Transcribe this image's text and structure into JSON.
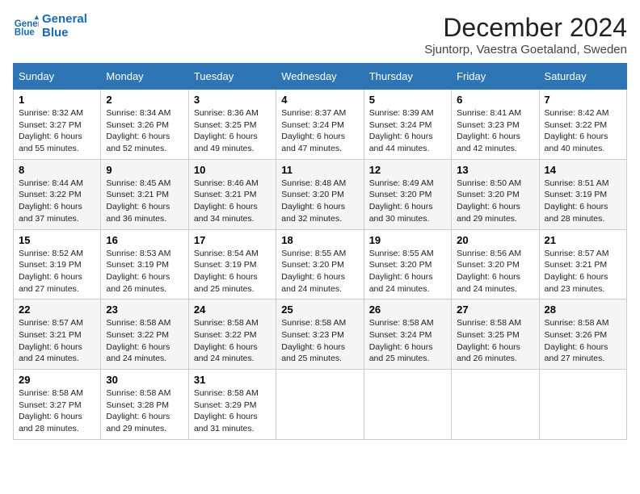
{
  "header": {
    "logo_line1": "General",
    "logo_line2": "Blue",
    "title": "December 2024",
    "subtitle": "Sjuntorp, Vaestra Goetaland, Sweden"
  },
  "columns": [
    "Sunday",
    "Monday",
    "Tuesday",
    "Wednesday",
    "Thursday",
    "Friday",
    "Saturday"
  ],
  "weeks": [
    [
      {
        "day": "1",
        "sunrise": "Sunrise: 8:32 AM",
        "sunset": "Sunset: 3:27 PM",
        "daylight": "Daylight: 6 hours and 55 minutes."
      },
      {
        "day": "2",
        "sunrise": "Sunrise: 8:34 AM",
        "sunset": "Sunset: 3:26 PM",
        "daylight": "Daylight: 6 hours and 52 minutes."
      },
      {
        "day": "3",
        "sunrise": "Sunrise: 8:36 AM",
        "sunset": "Sunset: 3:25 PM",
        "daylight": "Daylight: 6 hours and 49 minutes."
      },
      {
        "day": "4",
        "sunrise": "Sunrise: 8:37 AM",
        "sunset": "Sunset: 3:24 PM",
        "daylight": "Daylight: 6 hours and 47 minutes."
      },
      {
        "day": "5",
        "sunrise": "Sunrise: 8:39 AM",
        "sunset": "Sunset: 3:24 PM",
        "daylight": "Daylight: 6 hours and 44 minutes."
      },
      {
        "day": "6",
        "sunrise": "Sunrise: 8:41 AM",
        "sunset": "Sunset: 3:23 PM",
        "daylight": "Daylight: 6 hours and 42 minutes."
      },
      {
        "day": "7",
        "sunrise": "Sunrise: 8:42 AM",
        "sunset": "Sunset: 3:22 PM",
        "daylight": "Daylight: 6 hours and 40 minutes."
      }
    ],
    [
      {
        "day": "8",
        "sunrise": "Sunrise: 8:44 AM",
        "sunset": "Sunset: 3:22 PM",
        "daylight": "Daylight: 6 hours and 37 minutes."
      },
      {
        "day": "9",
        "sunrise": "Sunrise: 8:45 AM",
        "sunset": "Sunset: 3:21 PM",
        "daylight": "Daylight: 6 hours and 36 minutes."
      },
      {
        "day": "10",
        "sunrise": "Sunrise: 8:46 AM",
        "sunset": "Sunset: 3:21 PM",
        "daylight": "Daylight: 6 hours and 34 minutes."
      },
      {
        "day": "11",
        "sunrise": "Sunrise: 8:48 AM",
        "sunset": "Sunset: 3:20 PM",
        "daylight": "Daylight: 6 hours and 32 minutes."
      },
      {
        "day": "12",
        "sunrise": "Sunrise: 8:49 AM",
        "sunset": "Sunset: 3:20 PM",
        "daylight": "Daylight: 6 hours and 30 minutes."
      },
      {
        "day": "13",
        "sunrise": "Sunrise: 8:50 AM",
        "sunset": "Sunset: 3:20 PM",
        "daylight": "Daylight: 6 hours and 29 minutes."
      },
      {
        "day": "14",
        "sunrise": "Sunrise: 8:51 AM",
        "sunset": "Sunset: 3:19 PM",
        "daylight": "Daylight: 6 hours and 28 minutes."
      }
    ],
    [
      {
        "day": "15",
        "sunrise": "Sunrise: 8:52 AM",
        "sunset": "Sunset: 3:19 PM",
        "daylight": "Daylight: 6 hours and 27 minutes."
      },
      {
        "day": "16",
        "sunrise": "Sunrise: 8:53 AM",
        "sunset": "Sunset: 3:19 PM",
        "daylight": "Daylight: 6 hours and 26 minutes."
      },
      {
        "day": "17",
        "sunrise": "Sunrise: 8:54 AM",
        "sunset": "Sunset: 3:19 PM",
        "daylight": "Daylight: 6 hours and 25 minutes."
      },
      {
        "day": "18",
        "sunrise": "Sunrise: 8:55 AM",
        "sunset": "Sunset: 3:20 PM",
        "daylight": "Daylight: 6 hours and 24 minutes."
      },
      {
        "day": "19",
        "sunrise": "Sunrise: 8:55 AM",
        "sunset": "Sunset: 3:20 PM",
        "daylight": "Daylight: 6 hours and 24 minutes."
      },
      {
        "day": "20",
        "sunrise": "Sunrise: 8:56 AM",
        "sunset": "Sunset: 3:20 PM",
        "daylight": "Daylight: 6 hours and 24 minutes."
      },
      {
        "day": "21",
        "sunrise": "Sunrise: 8:57 AM",
        "sunset": "Sunset: 3:21 PM",
        "daylight": "Daylight: 6 hours and 23 minutes."
      }
    ],
    [
      {
        "day": "22",
        "sunrise": "Sunrise: 8:57 AM",
        "sunset": "Sunset: 3:21 PM",
        "daylight": "Daylight: 6 hours and 24 minutes."
      },
      {
        "day": "23",
        "sunrise": "Sunrise: 8:58 AM",
        "sunset": "Sunset: 3:22 PM",
        "daylight": "Daylight: 6 hours and 24 minutes."
      },
      {
        "day": "24",
        "sunrise": "Sunrise: 8:58 AM",
        "sunset": "Sunset: 3:22 PM",
        "daylight": "Daylight: 6 hours and 24 minutes."
      },
      {
        "day": "25",
        "sunrise": "Sunrise: 8:58 AM",
        "sunset": "Sunset: 3:23 PM",
        "daylight": "Daylight: 6 hours and 25 minutes."
      },
      {
        "day": "26",
        "sunrise": "Sunrise: 8:58 AM",
        "sunset": "Sunset: 3:24 PM",
        "daylight": "Daylight: 6 hours and 25 minutes."
      },
      {
        "day": "27",
        "sunrise": "Sunrise: 8:58 AM",
        "sunset": "Sunset: 3:25 PM",
        "daylight": "Daylight: 6 hours and 26 minutes."
      },
      {
        "day": "28",
        "sunrise": "Sunrise: 8:58 AM",
        "sunset": "Sunset: 3:26 PM",
        "daylight": "Daylight: 6 hours and 27 minutes."
      }
    ],
    [
      {
        "day": "29",
        "sunrise": "Sunrise: 8:58 AM",
        "sunset": "Sunset: 3:27 PM",
        "daylight": "Daylight: 6 hours and 28 minutes."
      },
      {
        "day": "30",
        "sunrise": "Sunrise: 8:58 AM",
        "sunset": "Sunset: 3:28 PM",
        "daylight": "Daylight: 6 hours and 29 minutes."
      },
      {
        "day": "31",
        "sunrise": "Sunrise: 8:58 AM",
        "sunset": "Sunset: 3:29 PM",
        "daylight": "Daylight: 6 hours and 31 minutes."
      },
      null,
      null,
      null,
      null
    ]
  ]
}
